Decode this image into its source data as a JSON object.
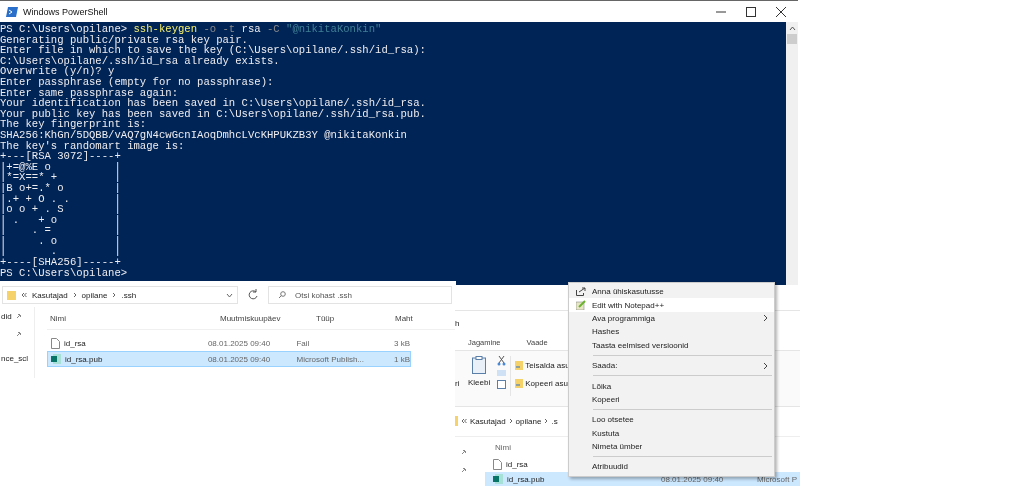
{
  "powershell": {
    "title": "Windows PowerShell",
    "command": [
      {
        "kind": "prompt",
        "text": "PS C:\\Users\\opilane>"
      },
      {
        "kind": "command",
        "text": "ssh-keygen"
      },
      {
        "kind": "param",
        "text": "-o -t"
      },
      {
        "kind": "arg",
        "text": "rsa"
      },
      {
        "kind": "param",
        "text": "-C"
      },
      {
        "kind": "string",
        "text": "\"@nikitaKonkin\""
      }
    ],
    "output": [
      "Generating public/private rsa key pair.",
      "Enter file in which to save the key (C:\\Users\\opilane/.ssh/id_rsa):",
      "C:\\Users\\opilane/.ssh/id_rsa already exists.",
      "Overwrite (y/n)? y",
      "Enter passphrase (empty for no passphrase):",
      "Enter same passphrase again:",
      "Your identification has been saved in C:\\Users\\opilane/.ssh/id_rsa.",
      "Your public key has been saved in C:\\Users\\opilane/.ssh/id_rsa.pub.",
      "The key fingerprint is:",
      "SHA256:KhGn/5DQBB/vAQ7gN4cwGcnIAoqDmhcLVcKHPUKZB3Y @nikitaKonkin",
      "The key's randomart image is:",
      "+---[RSA 3072]----+",
      "|+=@%E o          |",
      "|*=X==* +         |",
      "|B o+=.* o        |",
      "|.+ + O . .       |",
      "|o o + . S        |",
      "| .   + o         |",
      "|    . =          |",
      "|     . o         |",
      "|       .         |",
      "+----[SHA256]-----+",
      "PS C:\\Users\\opilane>"
    ]
  },
  "explorer": {
    "path": [
      "Kasutajad",
      "opilane",
      ".ssh"
    ],
    "search": {
      "placeholder": "Otsi kohast .ssh"
    },
    "nav_items": [
      "did",
      "nce_scl"
    ],
    "columns": [
      "Nimi",
      "Muutmiskuupäev",
      "Tüüp",
      "Maht"
    ],
    "rows": [
      {
        "kind": "file",
        "name": "id_rsa",
        "modified": "08.01.2025 09:40",
        "type": "Fail",
        "size": "3 kB",
        "selected": false
      },
      {
        "kind": "publisher",
        "name": "id_rsa.pub",
        "modified": "08.01.2025 09:40",
        "type": "Microsoft Publish...",
        "size": "1 kB",
        "selected": true
      }
    ]
  },
  "explorer_behind": {
    "title": "h",
    "ribbon_tabs": [
      "Jagamine",
      "Vaade"
    ],
    "paste_label_cut": "ri",
    "paste_label": "Kleebi",
    "ribbon_actions": [
      "Teisalda asu",
      "Kopeeri asu"
    ],
    "path": [
      "Kasutajad",
      "opilane",
      ".s"
    ],
    "column": "Nimi",
    "rows": [
      {
        "kind": "file",
        "name": "id_rsa",
        "selected": false
      },
      {
        "kind": "publisher",
        "name": "id_rsa.pub",
        "modified": "08.01.2025 09:40",
        "type": "Microsoft P",
        "selected": true
      }
    ]
  },
  "context_menu": [
    {
      "kind": "share",
      "label": "Anna ühiskasutusse",
      "submenu": false,
      "highlighted": false
    },
    {
      "kind": "notepad",
      "label": "Edit with Notepad++",
      "submenu": false,
      "highlighted": true
    },
    {
      "kind": "plain",
      "label": "Ava programmiga",
      "submenu": true,
      "highlighted": false
    },
    {
      "kind": "plain",
      "label": "Hashes",
      "submenu": false,
      "highlighted": false
    },
    {
      "kind": "plain",
      "label": "Taasta eelmised versioonid",
      "submenu": false,
      "highlighted": false
    },
    {
      "kind": "separator"
    },
    {
      "kind": "plain",
      "label": "Saada:",
      "submenu": true,
      "highlighted": false
    },
    {
      "kind": "separator"
    },
    {
      "kind": "plain",
      "label": "Lõika",
      "submenu": false,
      "highlighted": false
    },
    {
      "kind": "plain",
      "label": "Kopeeri",
      "submenu": false,
      "highlighted": false
    },
    {
      "kind": "separator"
    },
    {
      "kind": "plain",
      "label": "Loo otsetee",
      "submenu": false,
      "highlighted": false
    },
    {
      "kind": "plain",
      "label": "Kustuta",
      "submenu": false,
      "highlighted": false
    },
    {
      "kind": "plain",
      "label": "Nimeta ümber",
      "submenu": false,
      "highlighted": false
    },
    {
      "kind": "separator"
    },
    {
      "kind": "plain",
      "label": "Atribuudid",
      "submenu": false,
      "highlighted": false
    }
  ]
}
